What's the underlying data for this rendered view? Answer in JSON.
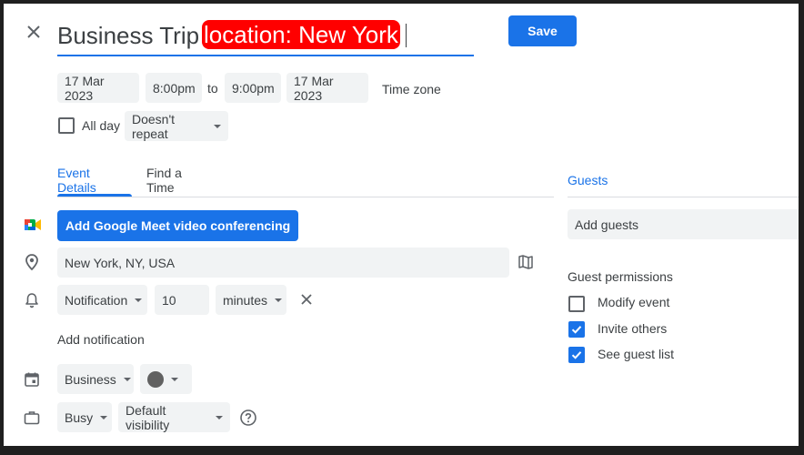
{
  "header": {
    "title_plain": "Business Trip ",
    "title_highlight": "location: New York",
    "save_label": "Save"
  },
  "datetime": {
    "start_date": "17 Mar 2023",
    "start_time": "8:00pm",
    "to_label": "to",
    "end_time": "9:00pm",
    "end_date": "17 Mar 2023",
    "time_zone_label": "Time zone"
  },
  "all_day": {
    "label": "All day",
    "checked": false
  },
  "repeat": {
    "value": "Doesn't repeat"
  },
  "tabs": [
    {
      "label": "Event Details",
      "active": true
    },
    {
      "label": "Find a Time",
      "active": false
    }
  ],
  "meet": {
    "label": "Add Google Meet video conferencing"
  },
  "location": {
    "value": "New York, NY, USA"
  },
  "notification": {
    "type": "Notification",
    "amount": "10",
    "unit": "minutes",
    "add_label": "Add notification"
  },
  "calendar": {
    "name": "Business",
    "color": "#616161"
  },
  "availability": {
    "status": "Busy",
    "visibility": "Default visibility"
  },
  "guests": {
    "tab_label": "Guests",
    "add_placeholder": "Add guests",
    "permissions_title": "Guest permissions",
    "permissions": [
      {
        "label": "Modify event",
        "checked": false
      },
      {
        "label": "Invite others",
        "checked": true
      },
      {
        "label": "See guest list",
        "checked": true
      }
    ]
  },
  "colors": {
    "accent": "#1a73e8",
    "highlight": "#ff0000",
    "chip_bg": "#f1f3f4"
  }
}
